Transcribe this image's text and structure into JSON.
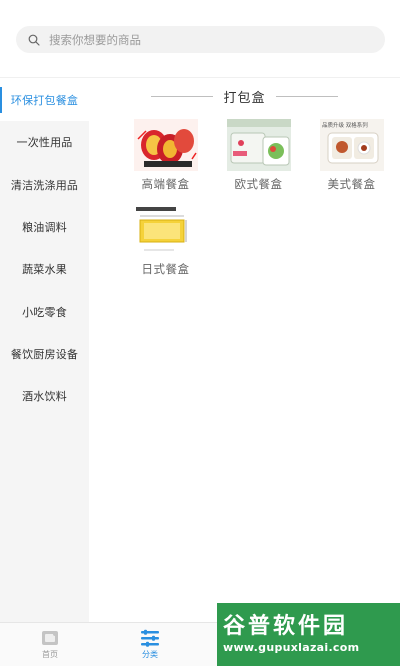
{
  "search": {
    "placeholder": "搜索你想要的商品"
  },
  "sidebar": {
    "items": [
      {
        "label": "环保打包餐盒",
        "active": true
      },
      {
        "label": "一次性用品"
      },
      {
        "label": "清洁洗涤用品"
      },
      {
        "label": "粮油调料"
      },
      {
        "label": "蔬菜水果"
      },
      {
        "label": "小吃零食"
      },
      {
        "label": "餐饮厨房设备"
      },
      {
        "label": "酒水饮料"
      }
    ]
  },
  "main": {
    "section_title": "打包盒",
    "products": [
      {
        "name": "高端餐盒"
      },
      {
        "name": "欧式餐盒"
      },
      {
        "name": "美式餐盒",
        "thumb_text": "品质升级 双格系列"
      },
      {
        "name": "日式餐盒"
      }
    ]
  },
  "bottom_nav": {
    "items": [
      {
        "label": "首页",
        "icon": "home-icon"
      },
      {
        "label": "分类",
        "icon": "category-icon",
        "active": true
      }
    ]
  },
  "watermark": {
    "main": "谷普软件园",
    "url": "www.gupuxlazai.com"
  },
  "colors": {
    "accent": "#2a8fe0",
    "sidebar_bg": "#f5f5f5",
    "watermark_bg": "#2f9a4e"
  }
}
